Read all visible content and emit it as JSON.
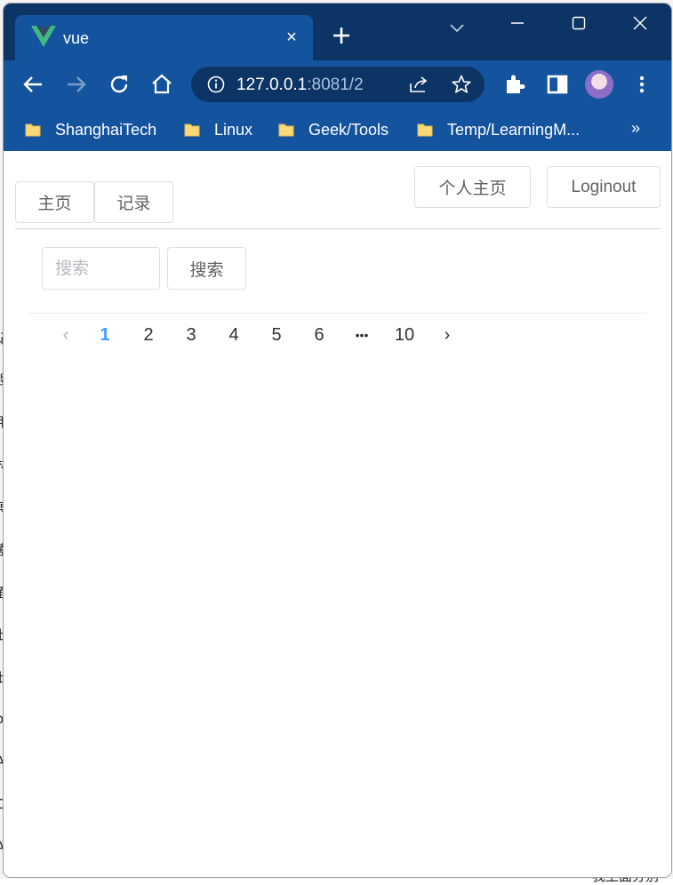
{
  "browser": {
    "tab": {
      "title": "vue",
      "close_glyph": "×"
    },
    "newtab_icon": "plus-icon",
    "window_controls": [
      "chevron-down-icon",
      "minimize-icon",
      "maximize-icon",
      "close-icon"
    ],
    "omnibox": {
      "host": "127.0.0.1",
      "rest": ":8081/2"
    },
    "bookmarks": [
      {
        "label": "ShanghaiTech"
      },
      {
        "label": "Linux"
      },
      {
        "label": "Geek/Tools"
      },
      {
        "label": "Temp/LearningM..."
      }
    ],
    "bookmarks_more": "»",
    "accent": "#14539e",
    "frame": "#0c3565"
  },
  "nav": {
    "home_label": "主页",
    "records_label": "记录",
    "profile_label": "个人主页",
    "logout_label": "Loginout"
  },
  "search": {
    "placeholder": "搜索",
    "button_label": "搜索"
  },
  "pagination": {
    "prev": "‹",
    "pages": [
      "1",
      "2",
      "3",
      "4",
      "5",
      "6"
    ],
    "ellipsis": "•••",
    "last": "10",
    "next": "›",
    "current": "1",
    "active_color": "#409eff"
  },
  "behind_window": {
    "left_chars": [
      "记",
      "搜",
      "用",
      "林",
      "博",
      "索",
      "面",
      "此",
      "此",
      "o",
      "A",
      "C",
      "A"
    ],
    "bottom_right": "我上面分别"
  }
}
